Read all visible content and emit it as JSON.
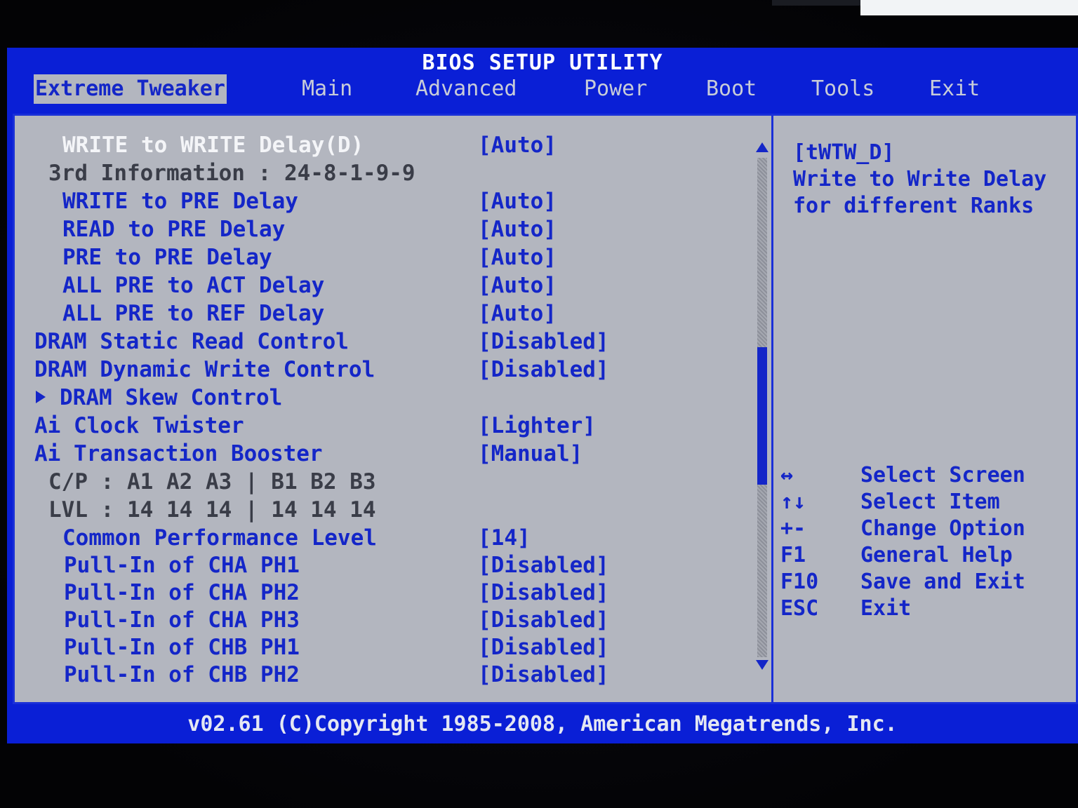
{
  "title": "BIOS SETUP UTILITY",
  "menu": {
    "tabs": [
      {
        "label": "Extreme Tweaker",
        "active": true
      },
      {
        "label": "Main",
        "active": false
      },
      {
        "label": "Advanced",
        "active": false
      },
      {
        "label": "Power",
        "active": false
      },
      {
        "label": "Boot",
        "active": false
      },
      {
        "label": "Tools",
        "active": false
      },
      {
        "label": "Exit",
        "active": false
      }
    ]
  },
  "settings": [
    {
      "label": "WRITE to WRITE Delay(D)",
      "value": "[Auto]",
      "style": "selected"
    },
    {
      "label": "3rd Information : 24-8-1-9-9",
      "value": "",
      "style": "info"
    },
    {
      "label": "WRITE to PRE Delay",
      "value": "[Auto]",
      "style": "item"
    },
    {
      "label": "READ to PRE Delay",
      "value": "[Auto]",
      "style": "item"
    },
    {
      "label": "PRE to PRE Delay",
      "value": "[Auto]",
      "style": "item"
    },
    {
      "label": "ALL PRE to ACT Delay",
      "value": "[Auto]",
      "style": "item"
    },
    {
      "label": "ALL PRE to REF Delay",
      "value": "[Auto]",
      "style": "item"
    },
    {
      "label": "DRAM Static Read Control",
      "value": "[Disabled]",
      "style": "item"
    },
    {
      "label": "DRAM Dynamic Write Control",
      "value": "[Disabled]",
      "style": "item"
    },
    {
      "label": "DRAM Skew Control",
      "value": "",
      "style": "submenu"
    },
    {
      "label": "Ai Clock Twister",
      "value": "[Lighter]",
      "style": "item"
    },
    {
      "label": "Ai Transaction Booster",
      "value": "[Manual]",
      "style": "item"
    },
    {
      "label": "C/P : A1 A2 A3 | B1 B2 B3",
      "value": "",
      "style": "info"
    },
    {
      "label": "LVL : 14 14 14 | 14 14 14",
      "value": "",
      "style": "info"
    },
    {
      "label": "Common Performance Level",
      "value": "[14]",
      "style": "item"
    },
    {
      "label": "Pull-In of CHA PH1",
      "value": "[Disabled]",
      "style": "item"
    },
    {
      "label": "Pull-In of CHA PH2",
      "value": "[Disabled]",
      "style": "item"
    },
    {
      "label": "Pull-In of CHA PH3",
      "value": "[Disabled]",
      "style": "item"
    },
    {
      "label": "Pull-In of CHB PH1",
      "value": "[Disabled]",
      "style": "item"
    },
    {
      "label": "Pull-In of CHB PH2",
      "value": "[Disabled]",
      "style": "item"
    }
  ],
  "help": {
    "lines": [
      "[tWTW_D]",
      "Write to Write Delay",
      "for different Ranks"
    ]
  },
  "keys": [
    {
      "key": "↔",
      "desc": "Select Screen"
    },
    {
      "key": "↑↓",
      "desc": "Select Item"
    },
    {
      "key": "+-",
      "desc": "Change Option"
    },
    {
      "key": "F1",
      "desc": "General Help"
    },
    {
      "key": "F10",
      "desc": "Save and Exit"
    },
    {
      "key": "ESC",
      "desc": "Exit"
    }
  ],
  "scroll": {
    "position": 0.38,
    "visible_fraction": 0.28
  },
  "footer": "v02.61 (C)Copyright 1985-2008, American Megatrends, Inc.",
  "colors": {
    "screen_blue": "#0a1fd6",
    "panel_gray": "#b3b6bf",
    "text_blue": "#1426c8",
    "text_white": "#f4f5f8"
  }
}
